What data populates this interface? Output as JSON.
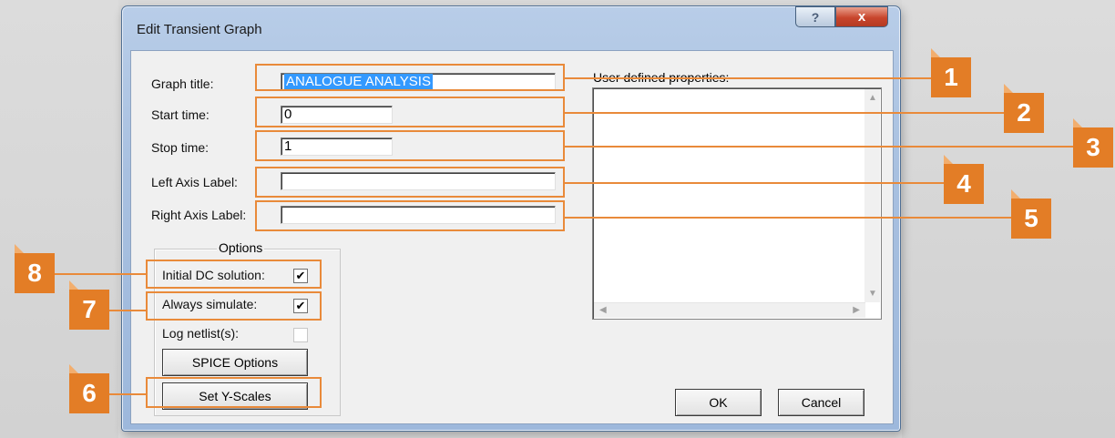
{
  "window": {
    "title": "Edit Transient Graph",
    "help_glyph": "?",
    "close_glyph": "x"
  },
  "fields": {
    "graph_title": {
      "label": "Graph title:",
      "value": "ANALOGUE ANALYSIS"
    },
    "start_time": {
      "label": "Start time:",
      "value": "0"
    },
    "stop_time": {
      "label": "Stop time:",
      "value": "1"
    },
    "left_axis_label": {
      "label": "Left Axis Label:",
      "value": ""
    },
    "right_axis_label": {
      "label": "Right Axis Label:",
      "value": ""
    }
  },
  "user_defined": {
    "label": "User defined properties:"
  },
  "options": {
    "legend": "Options",
    "initial_dc": {
      "label": "Initial DC solution:",
      "checked": true,
      "mark": "✔"
    },
    "always_simulate": {
      "label": "Always simulate:",
      "checked": true,
      "mark": "✔"
    },
    "log_netlist": {
      "label": "Log netlist(s):",
      "checked": false,
      "mark": ""
    }
  },
  "buttons": {
    "spice_options": "SPICE Options",
    "set_y_scales": "Set Y-Scales",
    "ok": "OK",
    "cancel": "Cancel"
  },
  "callouts": [
    "1",
    "2",
    "3",
    "4",
    "5",
    "6",
    "7",
    "8"
  ],
  "colors": {
    "callout": "#e37d26",
    "selection": "#3399ff",
    "frame": "#a8c0e0"
  }
}
